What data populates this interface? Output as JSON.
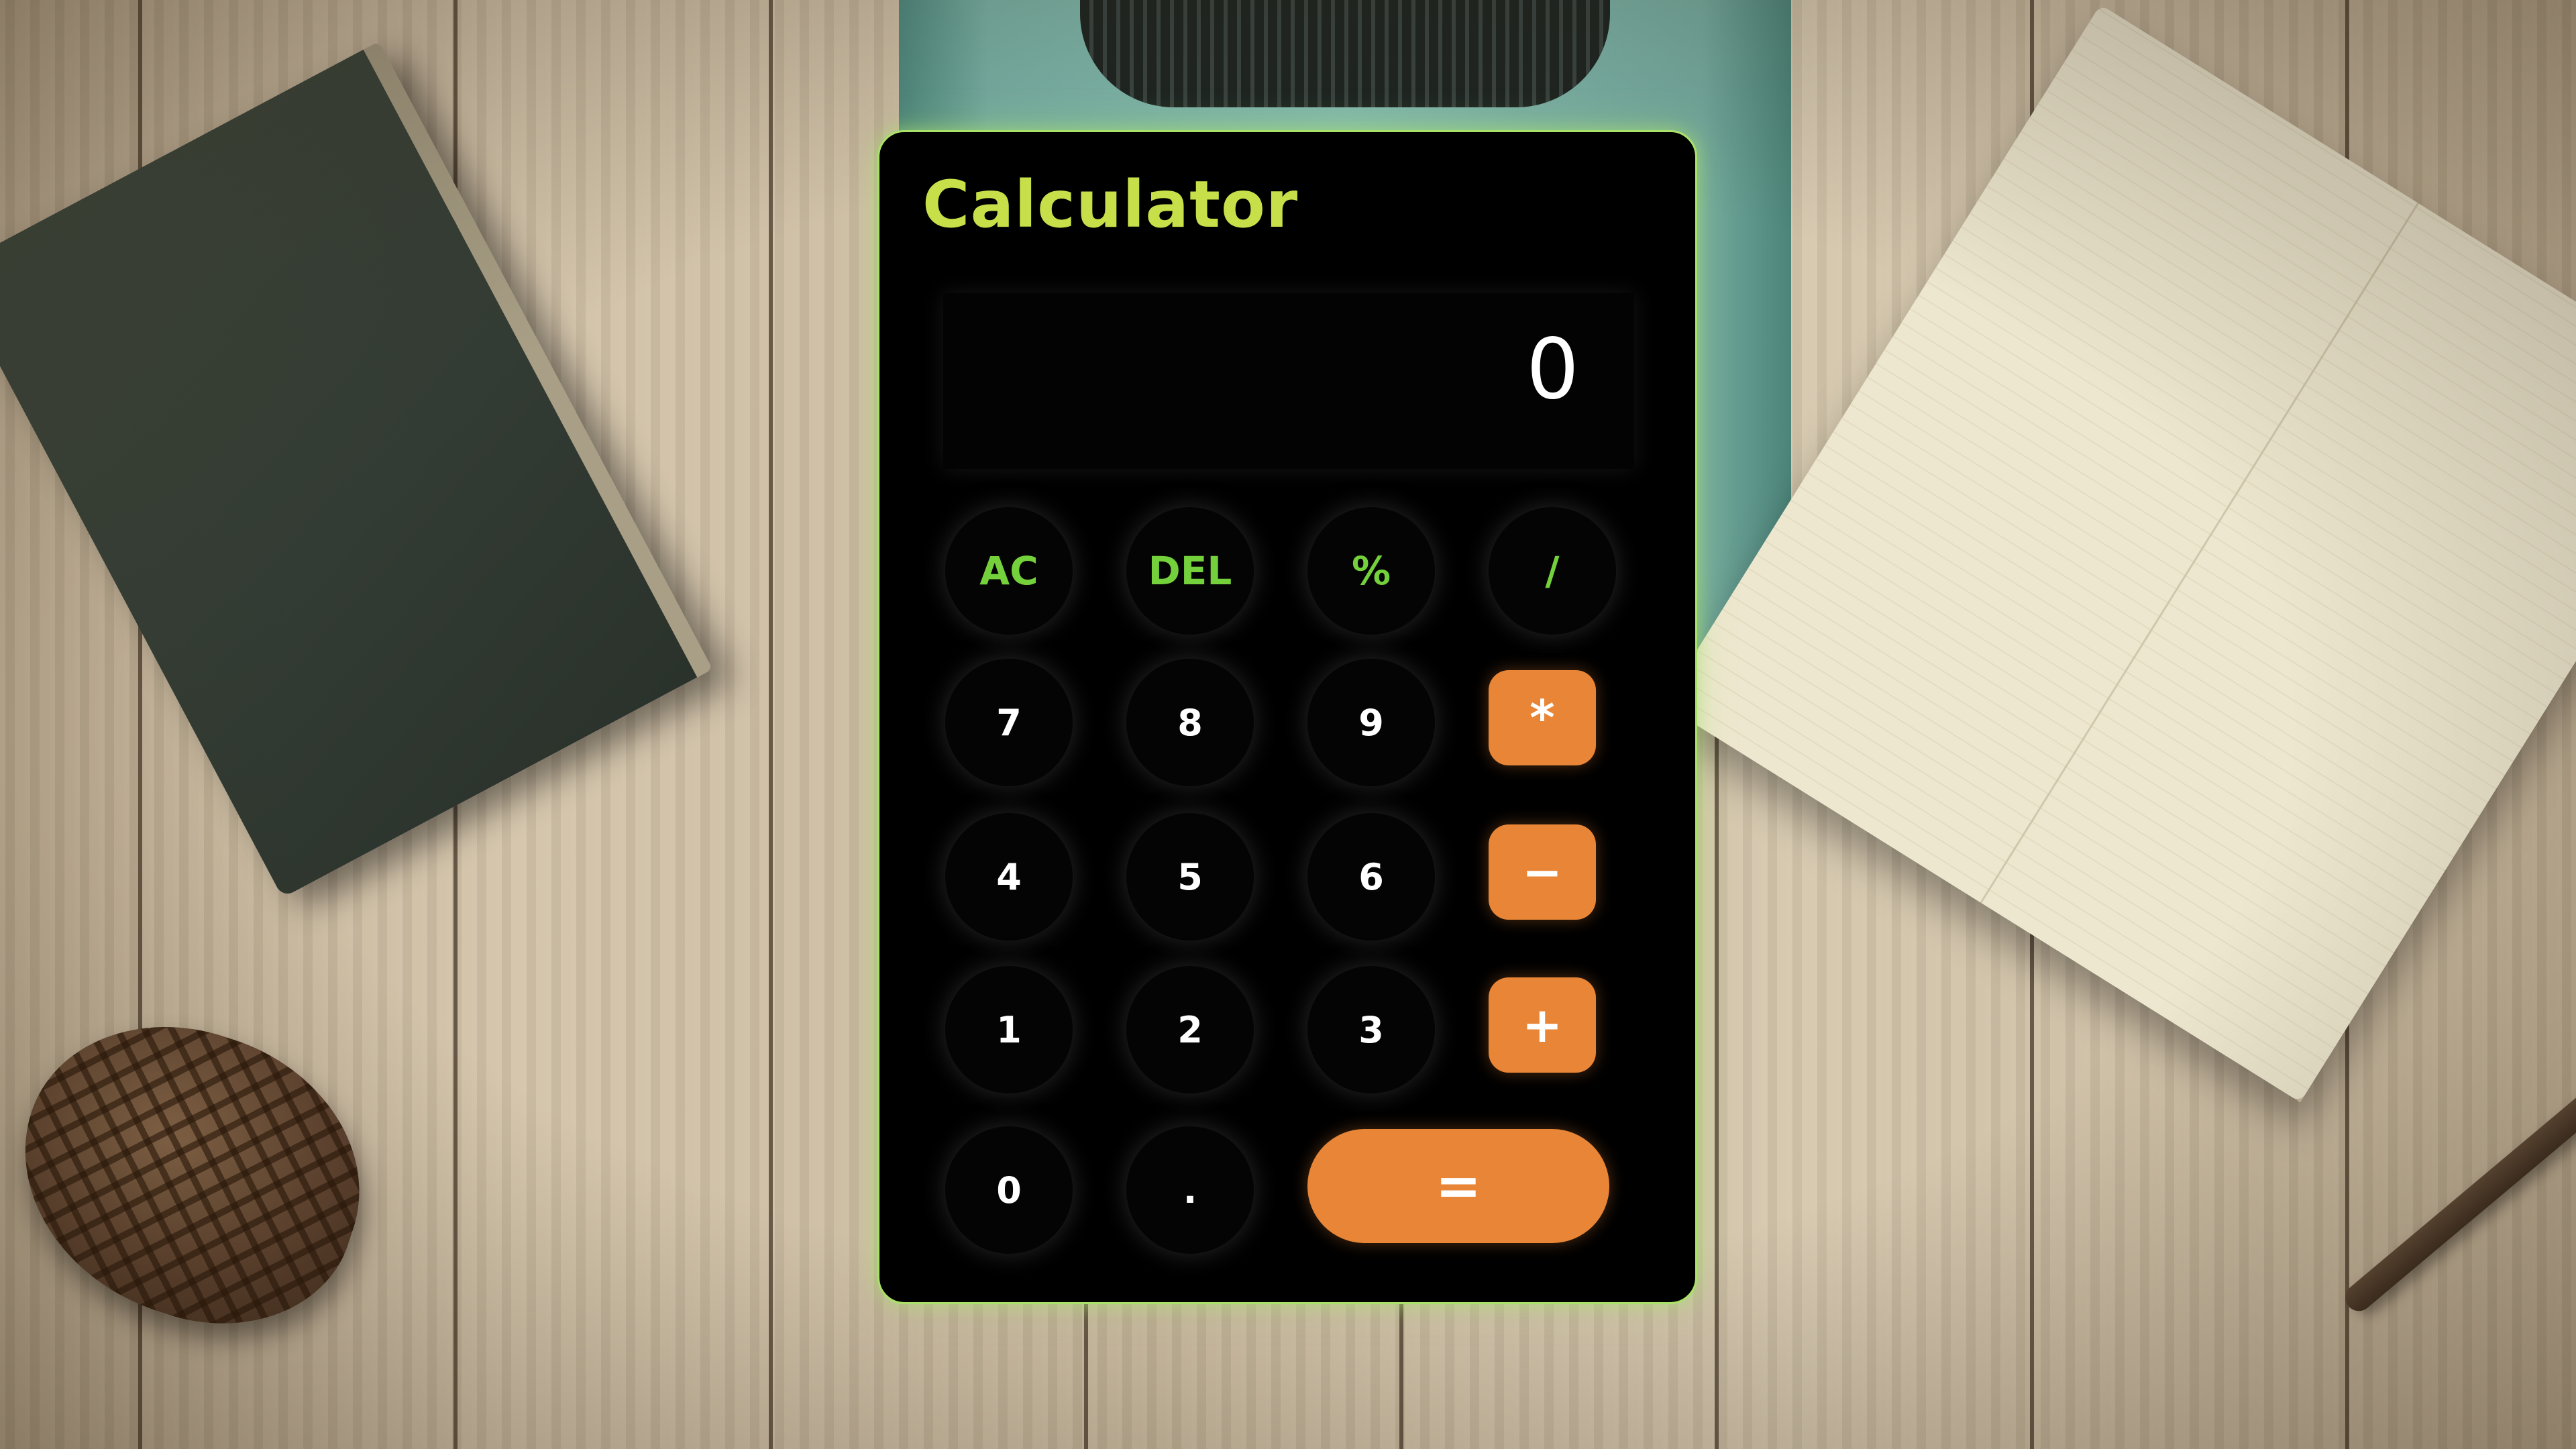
{
  "app": {
    "title": "Calculator"
  },
  "display": {
    "value": "0"
  },
  "keys": {
    "ac": "AC",
    "del": "DEL",
    "percent": "%",
    "divide": "/",
    "seven": "7",
    "eight": "8",
    "nine": "9",
    "multiply": "*",
    "four": "4",
    "five": "5",
    "six": "6",
    "minus": "−",
    "one": "1",
    "two": "2",
    "three": "3",
    "plus": "+",
    "zero": "0",
    "dot": ".",
    "equals": "="
  },
  "colors": {
    "title": "#c7e04a",
    "function_key_text": "#74d13c",
    "operator_key_bg": "#e88536",
    "panel_border_glow": "#a9e26b",
    "panel_bg": "#000000"
  }
}
